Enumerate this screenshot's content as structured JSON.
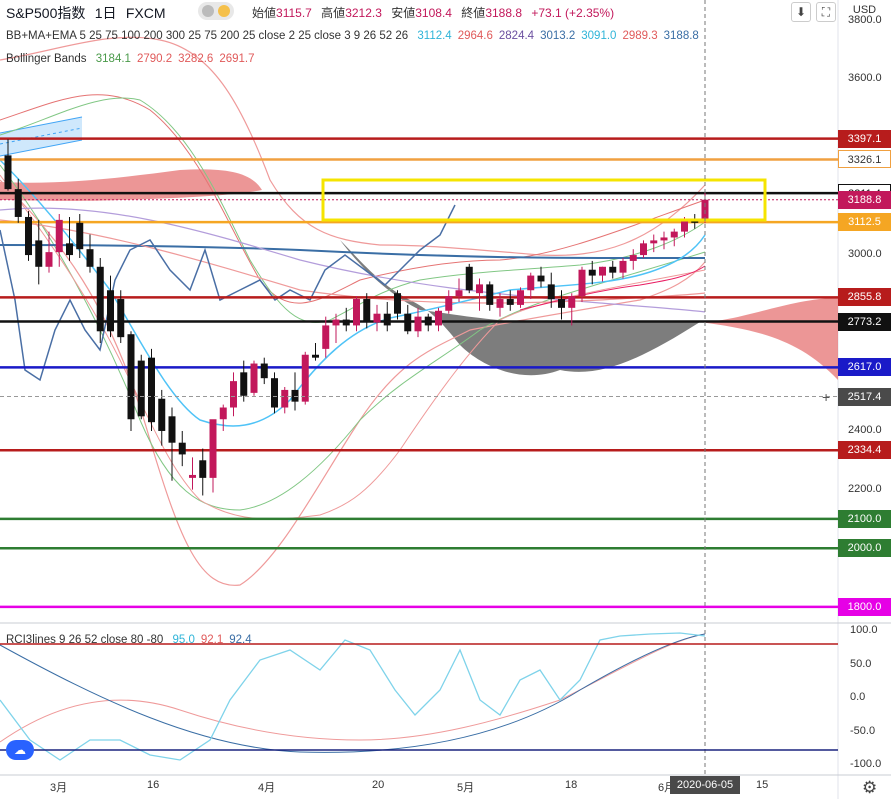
{
  "header": {
    "symbol": "S&P500指数",
    "interval": "1日",
    "source": "FXCM",
    "open_label": "始値",
    "open": "3115.7",
    "high_label": "高値",
    "high": "3212.3",
    "low_label": "安値",
    "low": "3108.4",
    "close_label": "終値",
    "close": "3188.8",
    "change": "+73.1 (+2.35%)"
  },
  "indicators": {
    "ma_ema_label": "BB+MA+EMA 5 25 75 100 200 300 25 75 200 25 close 2 25 close 3 9 26 52 26",
    "ma_ema_values": [
      {
        "v": "3112.4",
        "color": "#2fb4d8"
      },
      {
        "v": "2964.6",
        "color": "#e05a5a"
      },
      {
        "v": "2824.4",
        "color": "#6b4fa0"
      },
      {
        "v": "3013.2",
        "color": "#3a6ea5"
      },
      {
        "v": "3091.0",
        "color": "#2fb4d8"
      },
      {
        "v": "2989.3",
        "color": "#e05a5a"
      },
      {
        "v": "3188.8",
        "color": "#3a6ea5"
      }
    ],
    "bb_label": "Bollinger Bands",
    "bb_values": [
      {
        "v": "3184.1",
        "color": "#4a9a4a"
      },
      {
        "v": "2790.2",
        "color": "#e05a5a"
      },
      {
        "v": "3282.6",
        "color": "#e05a5a"
      },
      {
        "v": "2691.7",
        "color": "#e05a5a"
      }
    ],
    "rci_label": "RCI3lines 9 26 52 close 80 -80",
    "rci_values": [
      {
        "v": "95.0",
        "color": "#2fb4d8"
      },
      {
        "v": "92.1",
        "color": "#e05a5a"
      },
      {
        "v": "92.4",
        "color": "#3a6ea5"
      }
    ]
  },
  "currency": "USD",
  "toolbar": {
    "collapse_icon": "arrow-down-icon",
    "maximize_icon": "maximize-icon"
  },
  "settings_icon": "gear-icon",
  "price_axis": {
    "ticks": [
      "3800.0",
      "3600.0",
      "3211.4",
      "3000.0",
      "2600.0",
      "2517.4",
      "2400.0",
      "2200.0",
      "1800.0"
    ],
    "tick_values": [
      3800,
      3600,
      3211.4,
      3000,
      2600,
      2517.4,
      2400,
      2200,
      1800
    ],
    "range": [
      1745,
      3870
    ]
  },
  "horizontal_lines": [
    {
      "label": "3397.1",
      "value": 3397.1,
      "color": "#b71c1c"
    },
    {
      "label": "3326.1",
      "value": 3326.1,
      "color": "#f0a040"
    },
    {
      "label": "3211.4",
      "value": 3211.4,
      "color": "#111111"
    },
    {
      "label": "3188.8",
      "value": 3188.8,
      "color": "#c2185b"
    },
    {
      "label": "3112.5",
      "value": 3112.5,
      "color": "#f5a623"
    },
    {
      "label": "2855.8",
      "value": 2855.8,
      "color": "#b71c1c"
    },
    {
      "label": "2773.2",
      "value": 2773.2,
      "color": "#111111"
    },
    {
      "label": "2617.0",
      "value": 2617.0,
      "color": "#1a1ac8"
    },
    {
      "label": "2334.4",
      "value": 2334.4,
      "color": "#b71c1c"
    },
    {
      "label": "2100.0",
      "value": 2100.0,
      "color": "#2e7d32"
    },
    {
      "label": "2000.0",
      "value": 2000.0,
      "color": "#2e7d32"
    },
    {
      "label": "1800.0",
      "value": 1800.0,
      "color": "#e600e6"
    }
  ],
  "crosshair_price": "2517.4",
  "crosshair_value": 2517.4,
  "date_axis": {
    "ticks": [
      "3月",
      "16",
      "4月",
      "20",
      "5月",
      "18",
      "6月",
      "15"
    ],
    "cursor_date": "2020-06-05"
  },
  "rci_axis": {
    "ticks": [
      "100.0",
      "50.0",
      "0.0",
      "-50.0",
      "-100.0"
    ],
    "values": [
      100,
      50,
      0,
      -50,
      -100
    ],
    "levels": [
      80,
      -80
    ]
  },
  "chart_data": {
    "type": "candlestick",
    "title": "S&P500指数 1日 FXCM",
    "y_range": [
      1745,
      3870
    ],
    "candles": [
      {
        "o": 3340,
        "h": 3395,
        "l": 3220,
        "c": 3225
      },
      {
        "o": 3225,
        "h": 3260,
        "l": 3110,
        "c": 3130
      },
      {
        "o": 3130,
        "h": 3150,
        "l": 2980,
        "c": 3000
      },
      {
        "o": 3050,
        "h": 3120,
        "l": 2900,
        "c": 2960
      },
      {
        "o": 2960,
        "h": 3080,
        "l": 2940,
        "c": 3010
      },
      {
        "o": 3010,
        "h": 3140,
        "l": 2960,
        "c": 3120
      },
      {
        "o": 3040,
        "h": 3130,
        "l": 2980,
        "c": 3000
      },
      {
        "o": 3110,
        "h": 3140,
        "l": 2990,
        "c": 3020
      },
      {
        "o": 3020,
        "h": 3070,
        "l": 2940,
        "c": 2960
      },
      {
        "o": 2960,
        "h": 2990,
        "l": 2700,
        "c": 2740
      },
      {
        "o": 2880,
        "h": 2930,
        "l": 2720,
        "c": 2740
      },
      {
        "o": 2850,
        "h": 2880,
        "l": 2700,
        "c": 2720
      },
      {
        "o": 2730,
        "h": 2740,
        "l": 2400,
        "c": 2440
      },
      {
        "o": 2640,
        "h": 2660,
        "l": 2440,
        "c": 2450
      },
      {
        "o": 2650,
        "h": 2680,
        "l": 2400,
        "c": 2430
      },
      {
        "o": 2510,
        "h": 2540,
        "l": 2350,
        "c": 2400
      },
      {
        "o": 2450,
        "h": 2480,
        "l": 2230,
        "c": 2360
      },
      {
        "o": 2360,
        "h": 2400,
        "l": 2280,
        "c": 2320
      },
      {
        "o": 2240,
        "h": 2310,
        "l": 2200,
        "c": 2250
      },
      {
        "o": 2300,
        "h": 2340,
        "l": 2180,
        "c": 2240
      },
      {
        "o": 2240,
        "h": 2410,
        "l": 2190,
        "c": 2440
      },
      {
        "o": 2440,
        "h": 2490,
        "l": 2400,
        "c": 2480
      },
      {
        "o": 2480,
        "h": 2600,
        "l": 2450,
        "c": 2570
      },
      {
        "o": 2600,
        "h": 2640,
        "l": 2500,
        "c": 2520
      },
      {
        "o": 2530,
        "h": 2640,
        "l": 2520,
        "c": 2630
      },
      {
        "o": 2630,
        "h": 2650,
        "l": 2560,
        "c": 2580
      },
      {
        "o": 2580,
        "h": 2600,
        "l": 2460,
        "c": 2480
      },
      {
        "o": 2480,
        "h": 2550,
        "l": 2460,
        "c": 2540
      },
      {
        "o": 2540,
        "h": 2600,
        "l": 2470,
        "c": 2500
      },
      {
        "o": 2500,
        "h": 2670,
        "l": 2490,
        "c": 2660
      },
      {
        "o": 2660,
        "h": 2700,
        "l": 2640,
        "c": 2650
      },
      {
        "o": 2680,
        "h": 2790,
        "l": 2650,
        "c": 2760
      },
      {
        "o": 2760,
        "h": 2800,
        "l": 2700,
        "c": 2780
      },
      {
        "o": 2780,
        "h": 2820,
        "l": 2740,
        "c": 2760
      },
      {
        "o": 2760,
        "h": 2860,
        "l": 2740,
        "c": 2850
      },
      {
        "o": 2850,
        "h": 2870,
        "l": 2750,
        "c": 2770
      },
      {
        "o": 2770,
        "h": 2830,
        "l": 2740,
        "c": 2800
      },
      {
        "o": 2800,
        "h": 2840,
        "l": 2740,
        "c": 2760
      },
      {
        "o": 2870,
        "h": 2880,
        "l": 2780,
        "c": 2800
      },
      {
        "o": 2800,
        "h": 2830,
        "l": 2730,
        "c": 2740
      },
      {
        "o": 2740,
        "h": 2820,
        "l": 2720,
        "c": 2790
      },
      {
        "o": 2790,
        "h": 2800,
        "l": 2740,
        "c": 2760
      },
      {
        "o": 2760,
        "h": 2820,
        "l": 2740,
        "c": 2810
      },
      {
        "o": 2810,
        "h": 2880,
        "l": 2800,
        "c": 2860
      },
      {
        "o": 2860,
        "h": 2920,
        "l": 2840,
        "c": 2880
      },
      {
        "o": 2960,
        "h": 2970,
        "l": 2870,
        "c": 2880
      },
      {
        "o": 2870,
        "h": 2920,
        "l": 2810,
        "c": 2900
      },
      {
        "o": 2900,
        "h": 2910,
        "l": 2810,
        "c": 2830
      },
      {
        "o": 2820,
        "h": 2870,
        "l": 2790,
        "c": 2850
      },
      {
        "o": 2850,
        "h": 2880,
        "l": 2810,
        "c": 2830
      },
      {
        "o": 2830,
        "h": 2890,
        "l": 2820,
        "c": 2880
      },
      {
        "o": 2880,
        "h": 2940,
        "l": 2850,
        "c": 2930
      },
      {
        "o": 2930,
        "h": 2960,
        "l": 2890,
        "c": 2910
      },
      {
        "o": 2900,
        "h": 2940,
        "l": 2820,
        "c": 2850
      },
      {
        "o": 2850,
        "h": 2880,
        "l": 2780,
        "c": 2820
      },
      {
        "o": 2820,
        "h": 2870,
        "l": 2760,
        "c": 2860
      },
      {
        "o": 2860,
        "h": 2960,
        "l": 2840,
        "c": 2950
      },
      {
        "o": 2950,
        "h": 2980,
        "l": 2900,
        "c": 2930
      },
      {
        "o": 2930,
        "h": 2960,
        "l": 2910,
        "c": 2960
      },
      {
        "o": 2960,
        "h": 2980,
        "l": 2920,
        "c": 2940
      },
      {
        "o": 2940,
        "h": 2990,
        "l": 2920,
        "c": 2980
      },
      {
        "o": 2980,
        "h": 3020,
        "l": 2950,
        "c": 3000
      },
      {
        "o": 3000,
        "h": 3050,
        "l": 2990,
        "c": 3040
      },
      {
        "o": 3040,
        "h": 3070,
        "l": 3010,
        "c": 3050
      },
      {
        "o": 3050,
        "h": 3080,
        "l": 3020,
        "c": 3060
      },
      {
        "o": 3060,
        "h": 3090,
        "l": 3030,
        "c": 3080
      },
      {
        "o": 3080,
        "h": 3130,
        "l": 3060,
        "c": 3120
      },
      {
        "o": 3120,
        "h": 3140,
        "l": 3090,
        "c": 3110
      },
      {
        "o": 3115.7,
        "h": 3212.3,
        "l": 3108.4,
        "c": 3188.8
      }
    ]
  }
}
